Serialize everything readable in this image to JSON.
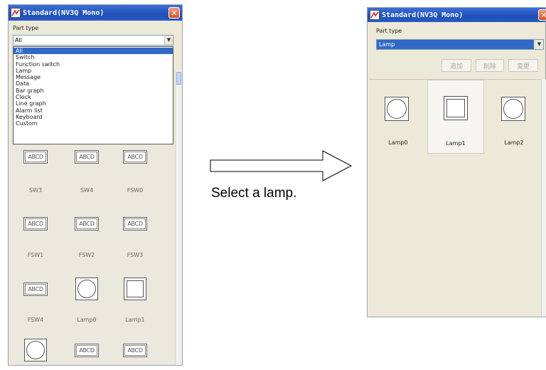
{
  "left_window": {
    "title": "Standard(NV3Q Mono)",
    "part_type_label": "Part type",
    "selected": "All",
    "dropdown_items": [
      "All",
      "Switch",
      "Function switch",
      "Lamp",
      "Message",
      "Data",
      "Bar graph",
      "Clock",
      "Line graph",
      "Alarm list",
      "Keyboard",
      "Custom"
    ],
    "parts_row1": [
      "ABCD",
      "ABCD",
      "ABCD"
    ],
    "captions_row1": [
      "SW3",
      "SW4",
      "FSW0"
    ],
    "parts_row2": [
      "ABCD",
      "ABCD",
      "ABCD"
    ],
    "captions_row2": [
      "FSW1",
      "FSW2",
      "FSW3"
    ],
    "parts_row3": [
      "ABCD"
    ],
    "captions_row3": [
      "FSW4",
      "Lamp0",
      "Lamp1"
    ],
    "parts_row4": [
      "ABCD",
      "ABCD"
    ]
  },
  "arrow_caption": "Select a lamp.",
  "right_window": {
    "title": "Standard(NV3Q Mono)",
    "part_type_label": "Part type",
    "selected": "Lamp",
    "buttons": [
      "追加",
      "削除",
      "変更"
    ],
    "lamps": [
      "Lamp0",
      "Lamp1",
      "Lamp2"
    ]
  },
  "colors": {
    "titlebar": "#1e4fb4",
    "selection": "#316ac5",
    "window_bg": "#ece9d8",
    "close_button": "#d9501c"
  },
  "icons": [
    "app-icon",
    "close-icon",
    "dropdown-arrow-icon",
    "right-arrow-icon"
  ]
}
